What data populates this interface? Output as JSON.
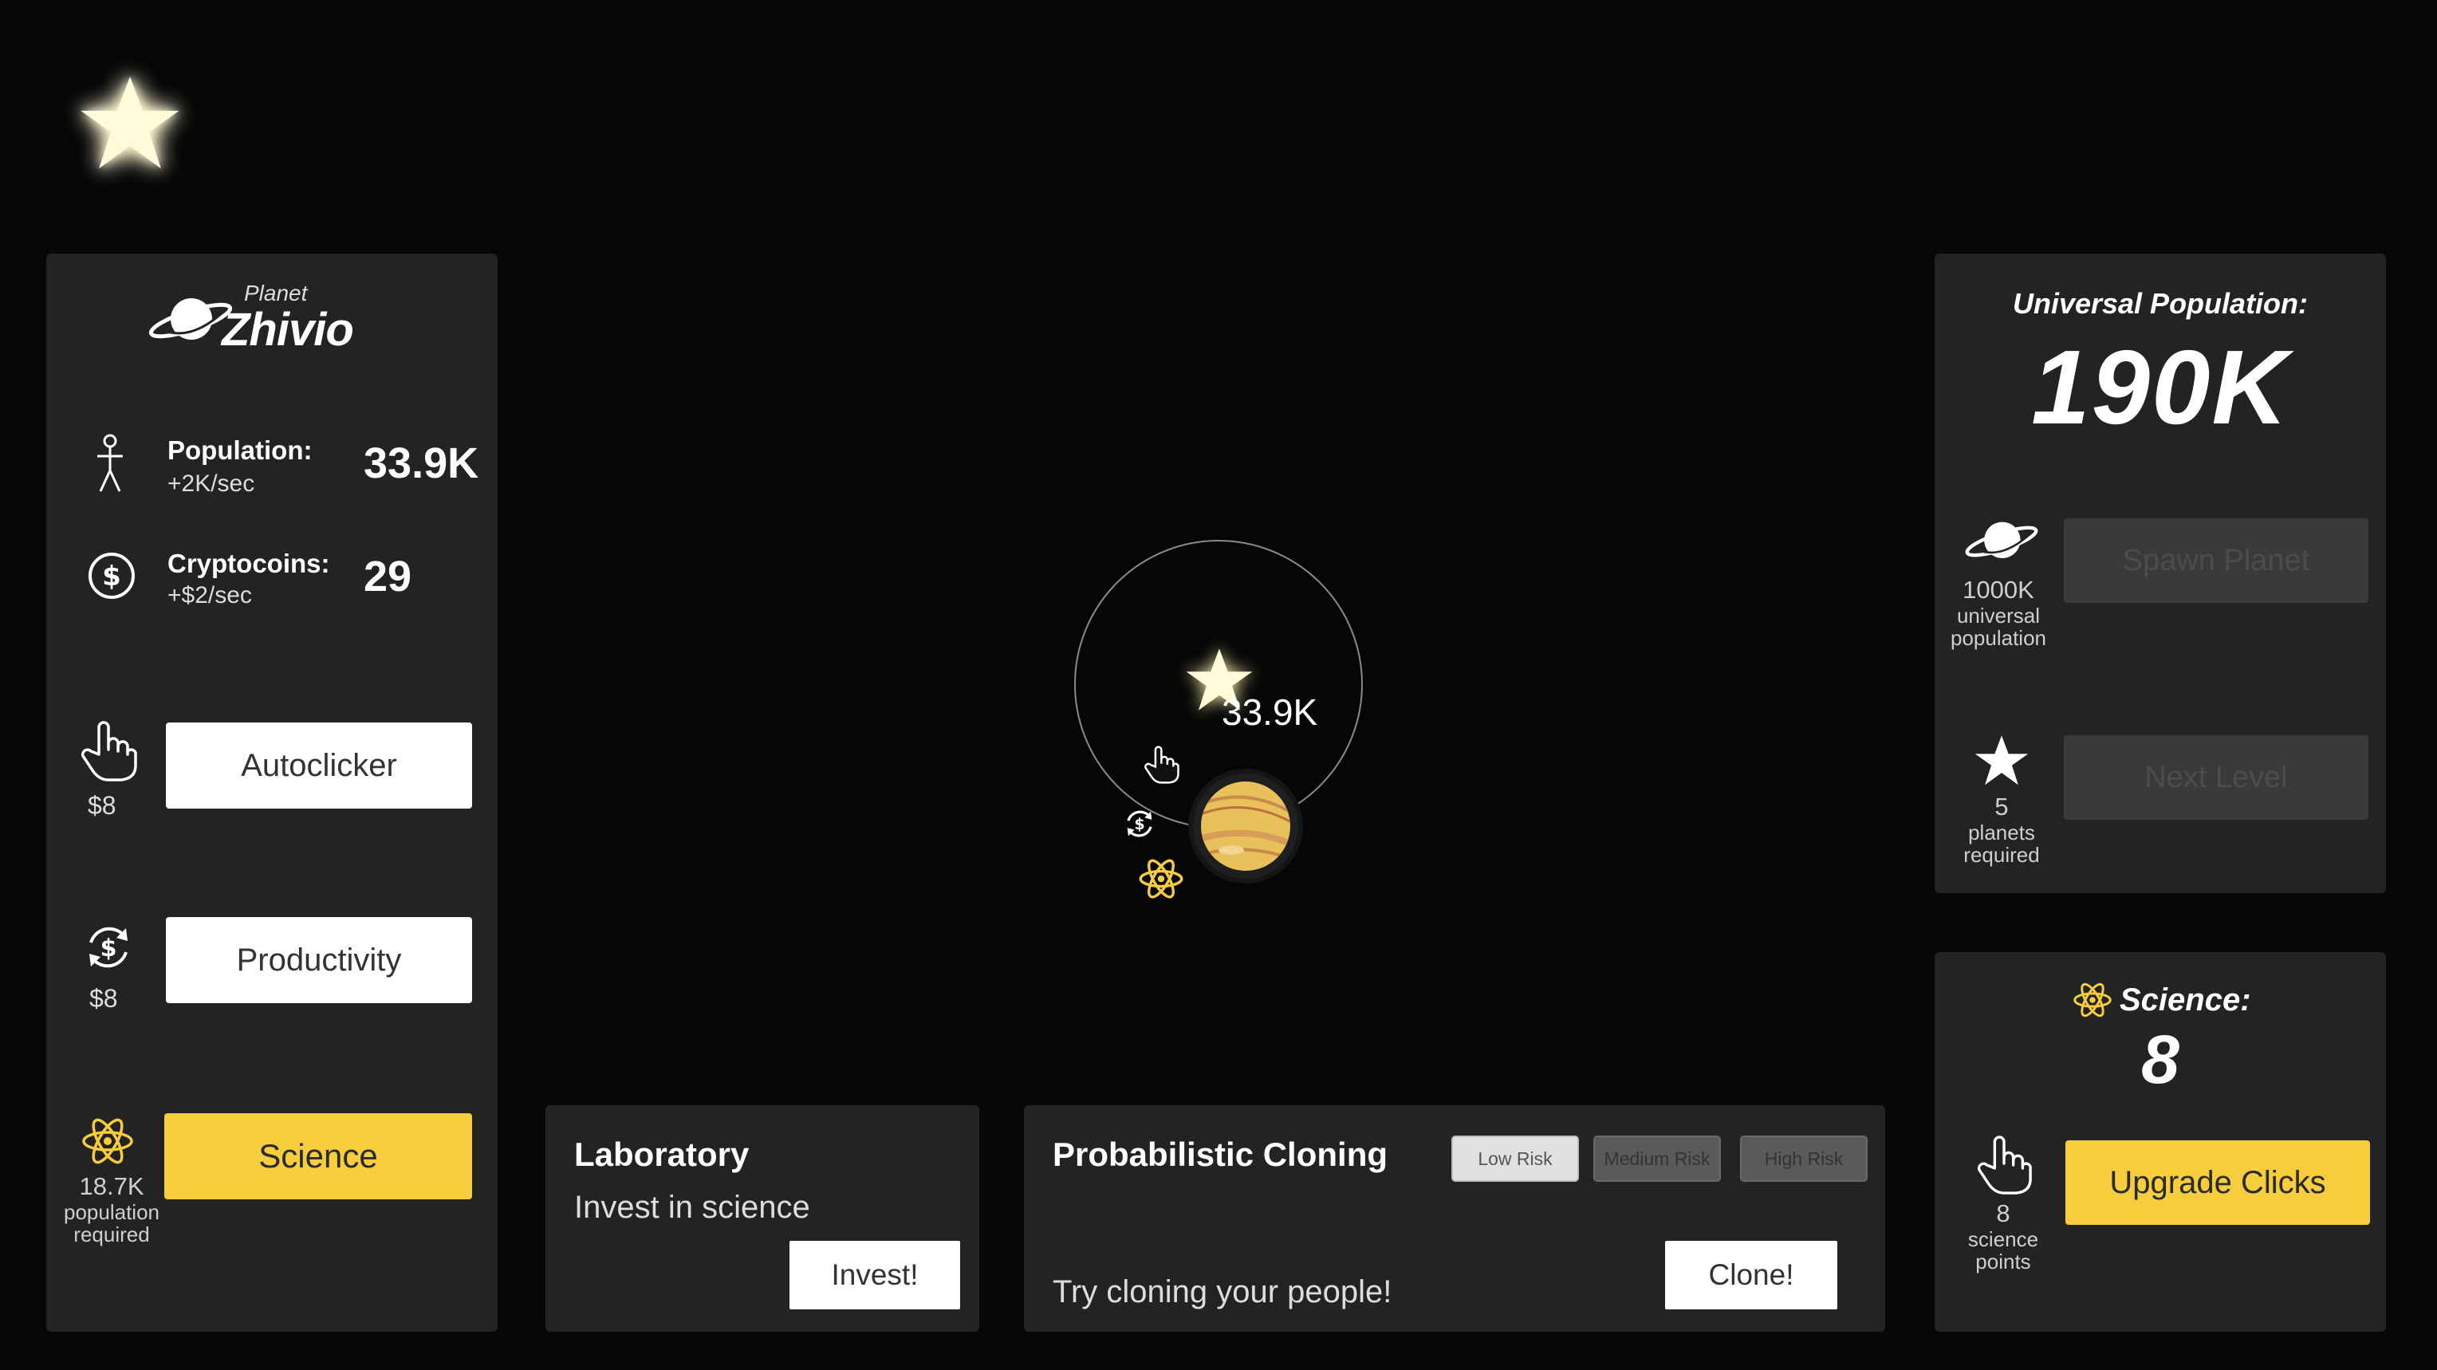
{
  "star_button": {
    "icon": "star-icon"
  },
  "planet_panel": {
    "planet_prefix": "Planet",
    "planet_name": "Zhivio",
    "population_label": "Population:",
    "population_rate": "+2K/sec",
    "population_value": "33.9K",
    "crypto_label": "Cryptocoins:",
    "crypto_rate": "+$2/sec",
    "crypto_value": "29",
    "autoclicker_cost": "$8",
    "autoclicker_label": "Autoclicker",
    "productivity_cost": "$8",
    "productivity_label": "Productivity",
    "science_requirement_value": "18.7K",
    "science_requirement_label_1": "population",
    "science_requirement_label_2": "required",
    "science_label": "Science"
  },
  "orbit_view": {
    "star_population": "33.9K"
  },
  "laboratory": {
    "title": "Laboratory",
    "description": "Invest in science",
    "button": "Invest!"
  },
  "cloning": {
    "title": "Probabilistic Cloning",
    "risk_options": [
      "Low Risk",
      "Medium Risk",
      "High Risk"
    ],
    "selected_risk": "Low Risk",
    "description": "Try cloning your people!",
    "button": "Clone!"
  },
  "universe_panel": {
    "title": "Universal Population:",
    "value": "190K",
    "spawn_requirement_value": "1000K",
    "spawn_requirement_label_1": "universal",
    "spawn_requirement_label_2": "population",
    "spawn_button": "Spawn Planet",
    "next_requirement_value": "5",
    "next_requirement_label_1": "planets",
    "next_requirement_label_2": "required",
    "next_button": "Next Level"
  },
  "science_panel": {
    "title": "Science:",
    "value": "8",
    "requirement_value": "8",
    "requirement_label_1": "science",
    "requirement_label_2": "points",
    "upgrade_button": "Upgrade Clicks"
  },
  "colors": {
    "background": "#060606",
    "panel": "#232323",
    "accent_yellow": "#f6cd3d",
    "disabled": "#3a3a3a"
  }
}
